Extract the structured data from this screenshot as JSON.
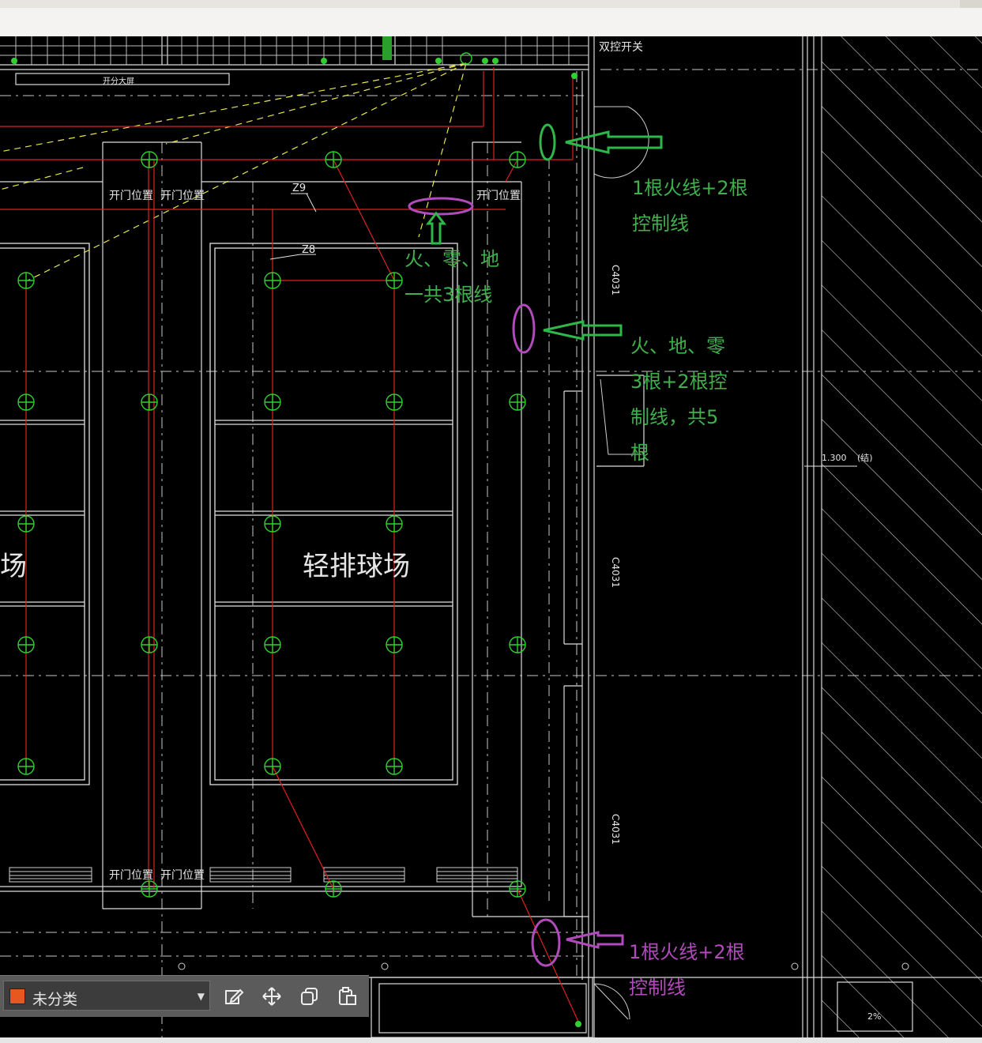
{
  "drawing": {
    "label_double_switch": "双控开关",
    "label_upgrade": "开分大屏",
    "door_labels": [
      "开门位置",
      "开门位置",
      "开门位置",
      "开门位置",
      "开门位置"
    ],
    "tag_z9": "Z9",
    "tag_z8": "Z8",
    "room_name": "轻排球场",
    "room_name_partial": "场",
    "window_code": "C4031",
    "elevation": "1.300",
    "elevation_note": "(结)",
    "slope": "2%"
  },
  "annotations": [
    {
      "text": "1根火线+2根\n控制线",
      "color": "#3fb04b"
    },
    {
      "text": "火、零、地\n一共3根线",
      "color": "#3fb04b"
    },
    {
      "text": "火、地、零\n3根+2根控\n制线，共5\n根",
      "color": "#3fb04b"
    },
    {
      "text": "1根火线+2根\n控制线",
      "color": "#b14aba"
    }
  ],
  "toolbar": {
    "layer_name": "未分类",
    "layer_color": "#e8571e",
    "tools": [
      "edit-icon",
      "move-icon",
      "copy-icon",
      "paste-icon"
    ]
  }
}
